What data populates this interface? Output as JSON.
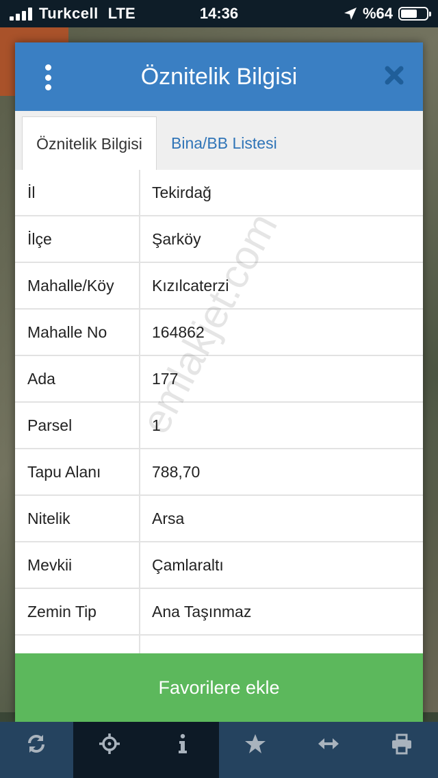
{
  "status_bar": {
    "carrier": "Turkcell",
    "network": "LTE",
    "time": "14:36",
    "battery_text": "%64",
    "battery_level": 0.64,
    "location_icon": "location-arrow-icon"
  },
  "dialog": {
    "title": "Öznitelik Bilgisi",
    "menu_icon": "more-vertical-icon",
    "close_icon": "close-icon",
    "tabs": [
      {
        "label": "Öznitelik Bilgisi",
        "active": true
      },
      {
        "label": "Bina/BB Listesi",
        "active": false
      }
    ],
    "rows": [
      {
        "key": "İl",
        "value": "Tekirdağ"
      },
      {
        "key": "İlçe",
        "value": "Şarköy"
      },
      {
        "key": "Mahalle/Köy",
        "value": "Kızılcaterzi"
      },
      {
        "key": "Mahalle No",
        "value": "164862"
      },
      {
        "key": "Ada",
        "value": "177"
      },
      {
        "key": "Parsel",
        "value": "1"
      },
      {
        "key": "Tapu Alanı",
        "value": "788,70"
      },
      {
        "key": "Nitelik",
        "value": "Arsa"
      },
      {
        "key": "Mevkii",
        "value": "Çamlaraltı"
      },
      {
        "key": "Zemin Tip",
        "value": "Ana Taşınmaz"
      },
      {
        "key": "",
        "value": ""
      }
    ],
    "favorite_button": "Favorilere ekle",
    "watermark": "emlakjet.com"
  },
  "toolbar": {
    "items": [
      {
        "icon": "refresh-icon"
      },
      {
        "icon": "crosshair-icon"
      },
      {
        "icon": "info-icon"
      },
      {
        "icon": "star-icon"
      },
      {
        "icon": "horizontal-arrows-icon"
      },
      {
        "icon": "print-icon"
      }
    ]
  },
  "colors": {
    "header_blue": "#3a7fc3",
    "tab_link_blue": "#2f74b7",
    "button_green": "#5cb85c",
    "toolbar_bg": "#25435f",
    "toolbar_active_bg": "#0d1a26"
  }
}
